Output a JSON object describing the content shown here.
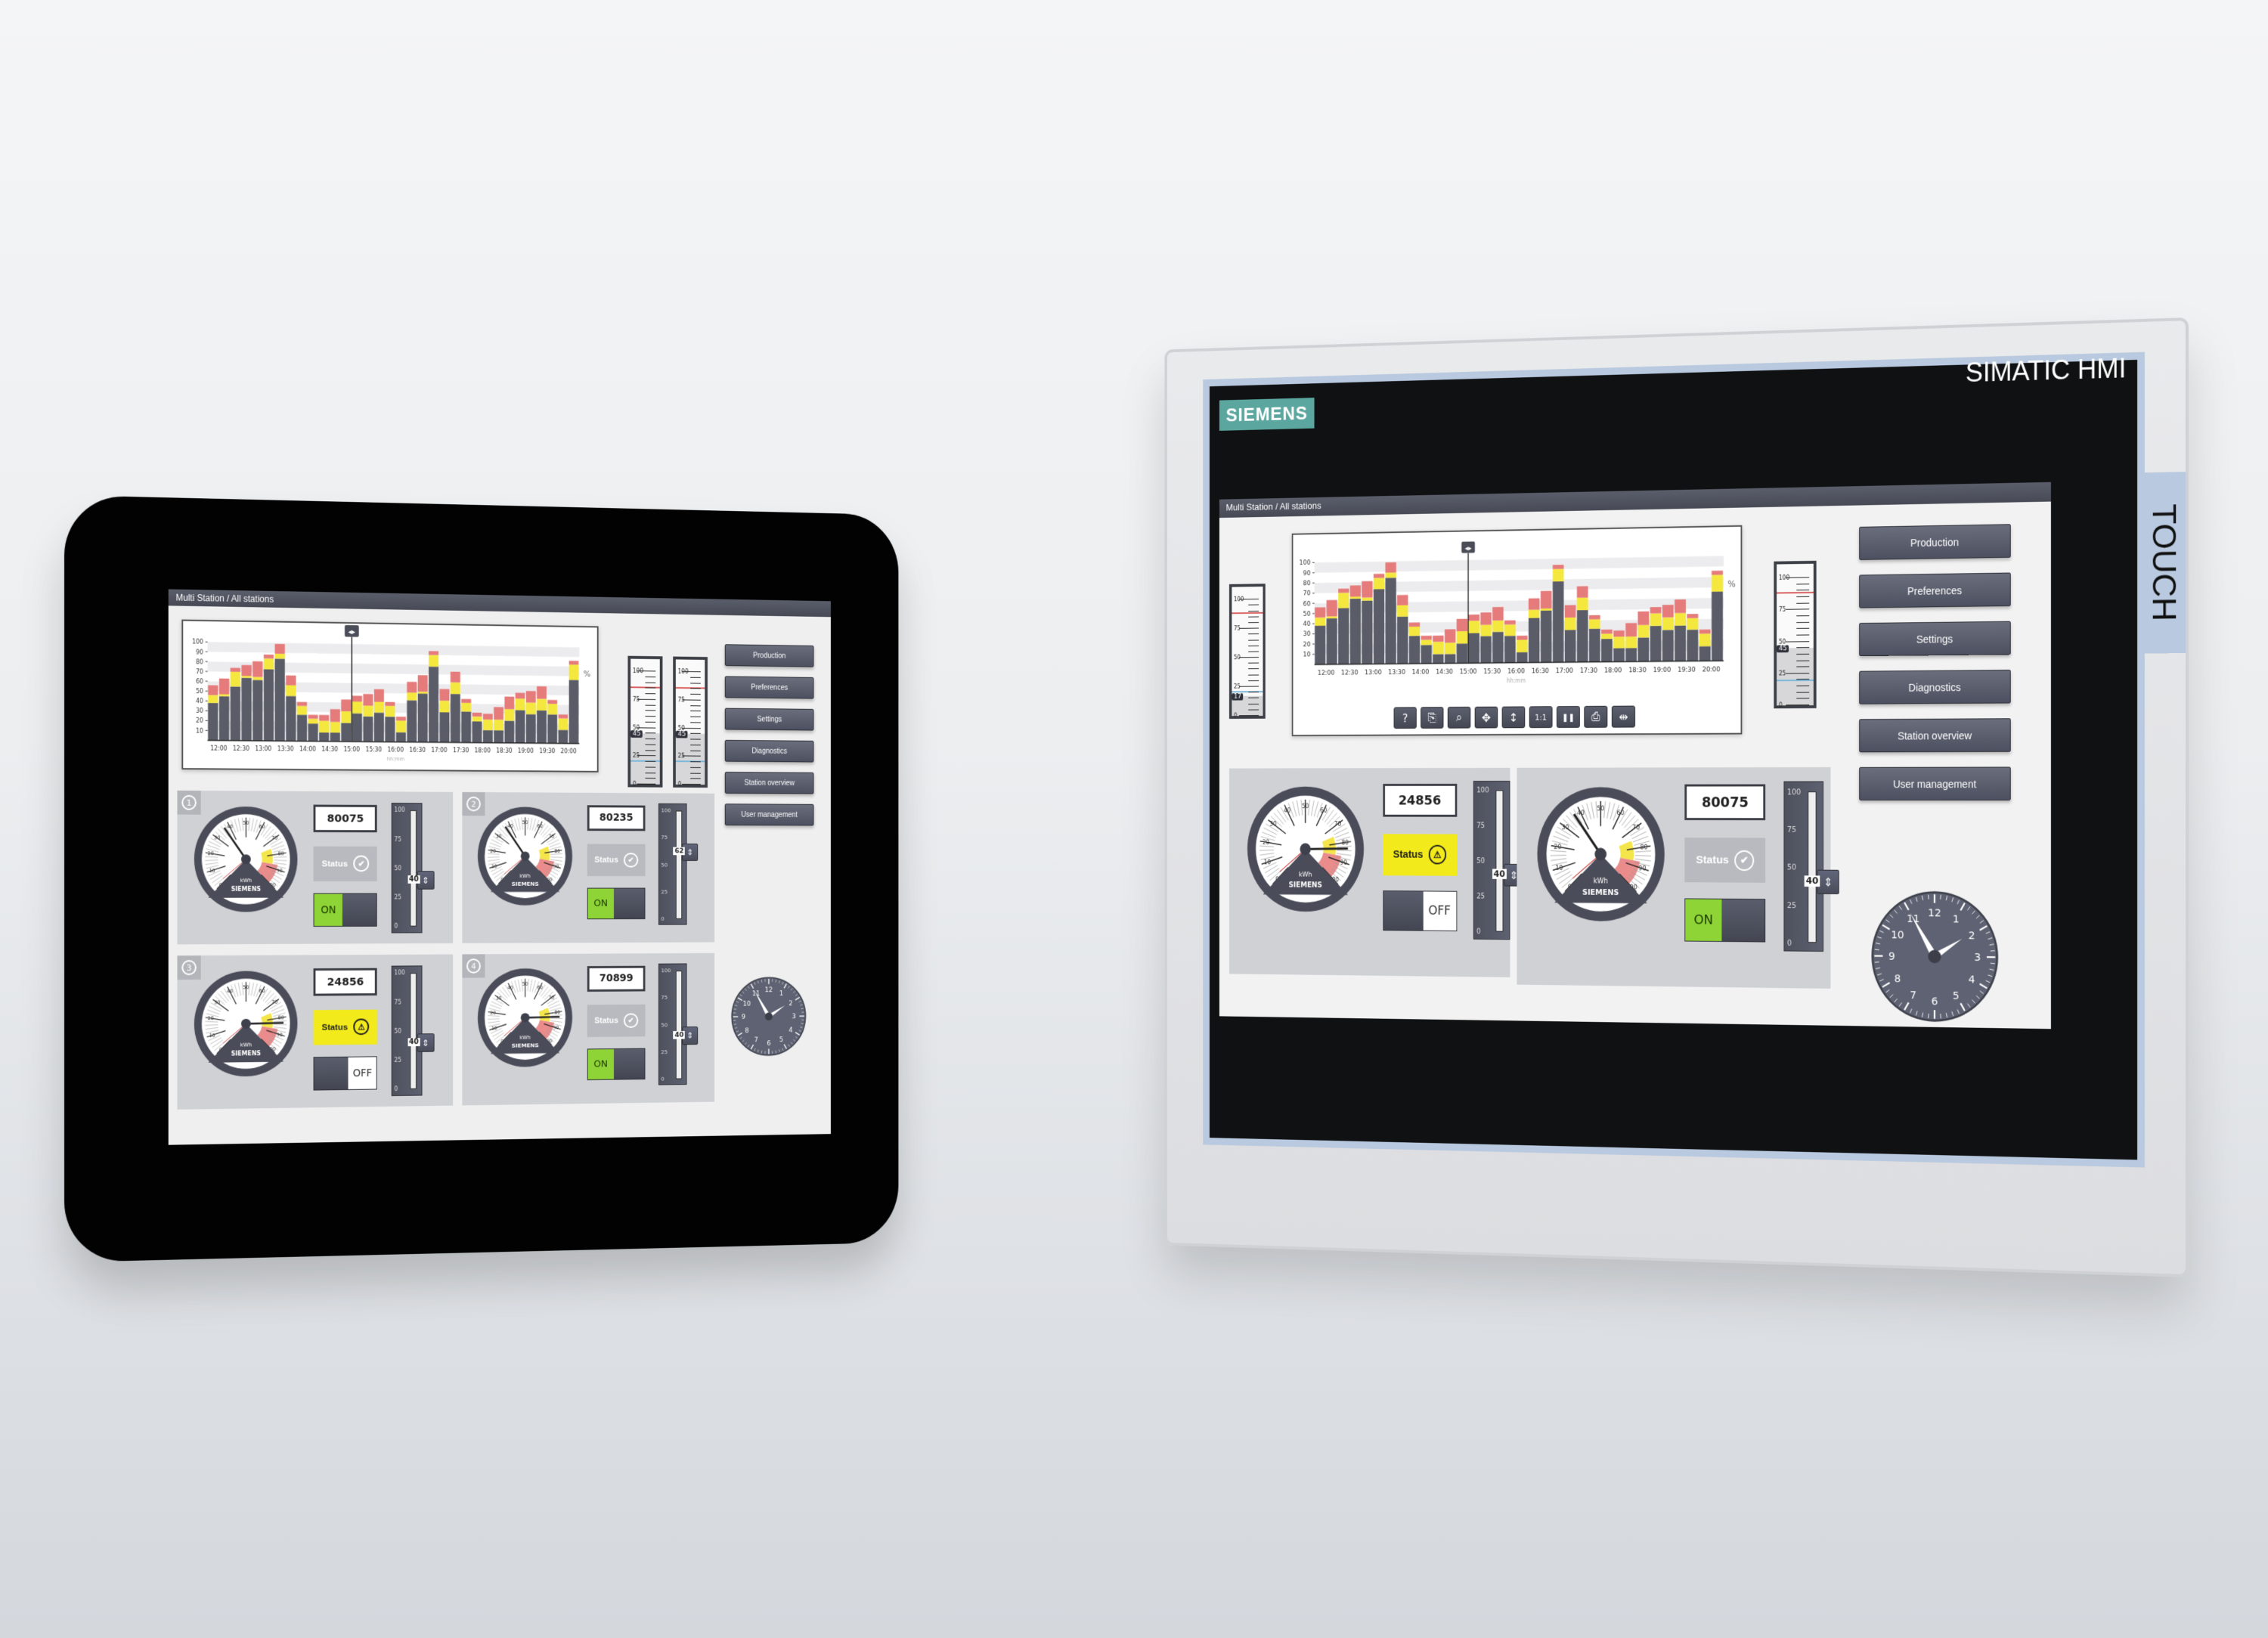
{
  "devices": {
    "left": {
      "screen_title": "Multi Station / All stations",
      "nav": [
        "Production",
        "Preferences",
        "Settings",
        "Diagnostics",
        "Station overview",
        "User management"
      ],
      "tanks": [
        {
          "value": 45,
          "hi": 85,
          "lo": 20,
          "scale": [
            "100",
            "75",
            "50",
            "25",
            "0"
          ]
        },
        {
          "value": 45,
          "hi": 85,
          "lo": 20,
          "scale": [
            "100",
            "75",
            "50",
            "25",
            "0"
          ]
        }
      ],
      "stations": [
        {
          "num": "1",
          "counter": "80075",
          "status": "Status",
          "status_state": "ok",
          "switch": "ON",
          "slider_value": 40,
          "gauge_value": 37
        },
        {
          "num": "2",
          "counter": "80235",
          "status": "Status",
          "status_state": "ok",
          "switch": "ON",
          "slider_value": 62,
          "gauge_value": 37
        },
        {
          "num": "3",
          "counter": "24856",
          "status": "Status",
          "status_state": "warn",
          "switch": "OFF",
          "slider_value": 40,
          "gauge_value": 83
        },
        {
          "num": "4",
          "counter": "70899",
          "status": "Status",
          "status_state": "ok",
          "switch": "ON",
          "slider_value": 40,
          "gauge_value": 83
        }
      ],
      "clock": {
        "hour": 1,
        "minute": 55
      }
    },
    "right": {
      "brand": "SIEMENS",
      "model": "SIMATIC HMI",
      "touch_label": "TOUCH",
      "screen_title": "Multi Station / All stations",
      "nav": [
        "Production",
        "Preferences",
        "Settings",
        "Diagnostics",
        "Station overview",
        "User management"
      ],
      "toolbar": [
        {
          "name": "help",
          "glyph": "?"
        },
        {
          "name": "export",
          "glyph": "⎘"
        },
        {
          "name": "zoom",
          "glyph": "⌕"
        },
        {
          "name": "pan",
          "glyph": "✥"
        },
        {
          "name": "vertical-scale",
          "glyph": "↕"
        },
        {
          "name": "original-size",
          "glyph": "1:1"
        },
        {
          "name": "pause",
          "glyph": "❚❚"
        },
        {
          "name": "print",
          "glyph": "⎙"
        },
        {
          "name": "ruler",
          "glyph": "⇹"
        }
      ],
      "tank_left": {
        "value": 17,
        "hi": 88,
        "lo": 20,
        "scale": [
          "100",
          "75",
          "50",
          "25",
          "0"
        ]
      },
      "tank_right": {
        "value": 45,
        "hi": 88,
        "lo": 19,
        "scale": [
          "100",
          "75",
          "50",
          "25",
          "0"
        ]
      },
      "stations": [
        {
          "counter": "24856",
          "status": "Status",
          "status_state": "warn",
          "switch": "OFF",
          "slider_value": 40,
          "gauge_value": 83
        },
        {
          "counter": "80075",
          "status": "Status",
          "status_state": "ok",
          "switch": "ON",
          "slider_value": 40,
          "gauge_value": 37
        }
      ],
      "gauge_unit": "kWh",
      "gauge_brand": "SIEMENS",
      "gauge_scale": [
        "0",
        "10",
        "20",
        "30",
        "40",
        "50",
        "60",
        "70",
        "80",
        "90",
        "100"
      ],
      "clock": {
        "hour": 1,
        "minute": 55
      }
    }
  },
  "chart_data": {
    "type": "bar",
    "stacked": true,
    "title": "",
    "xlabel": "hh:mm",
    "ylabel": "%",
    "ylim": [
      0,
      100
    ],
    "yticks": [
      10,
      20,
      30,
      40,
      50,
      60,
      70,
      80,
      90,
      100
    ],
    "x_tick_labels": [
      "12:00",
      "12:30",
      "13:00",
      "13:30",
      "14:00",
      "14:30",
      "15:00",
      "15:30",
      "16:00",
      "16:30",
      "17:00",
      "17:30",
      "18:00",
      "18:30",
      "19:00",
      "19:30",
      "20:00"
    ],
    "cursor_at": "15:00",
    "colors": {
      "base": "#5a5d68",
      "warning": "#f4e73e",
      "alarm": "#e57b7b"
    },
    "series": [
      {
        "name": "base",
        "values": [
          38,
          45,
          55,
          64,
          62,
          73,
          84,
          46,
          27,
          18,
          9,
          9,
          19,
          29,
          26,
          30,
          26,
          10,
          43,
          50,
          78,
          31,
          50,
          32,
          22,
          13,
          13,
          23,
          34,
          30,
          34,
          30,
          14,
          66
        ]
      },
      {
        "name": "warning",
        "values": [
          8,
          2,
          15,
          2,
          3,
          11,
          5,
          11,
          9,
          5,
          12,
          11,
          12,
          12,
          11,
          11,
          11,
          12,
          8,
          2,
          12,
          12,
          12,
          9,
          5,
          11,
          11,
          12,
          12,
          12,
          12,
          11,
          12,
          16
        ]
      },
      {
        "name": "alarm",
        "values": [
          10,
          16,
          4,
          11,
          16,
          4,
          10,
          10,
          4,
          4,
          6,
          13,
          12,
          6,
          12,
          13,
          4,
          4,
          11,
          17,
          4,
          12,
          11,
          4,
          4,
          6,
          13,
          13,
          6,
          12,
          13,
          4,
          4,
          4
        ]
      }
    ]
  }
}
